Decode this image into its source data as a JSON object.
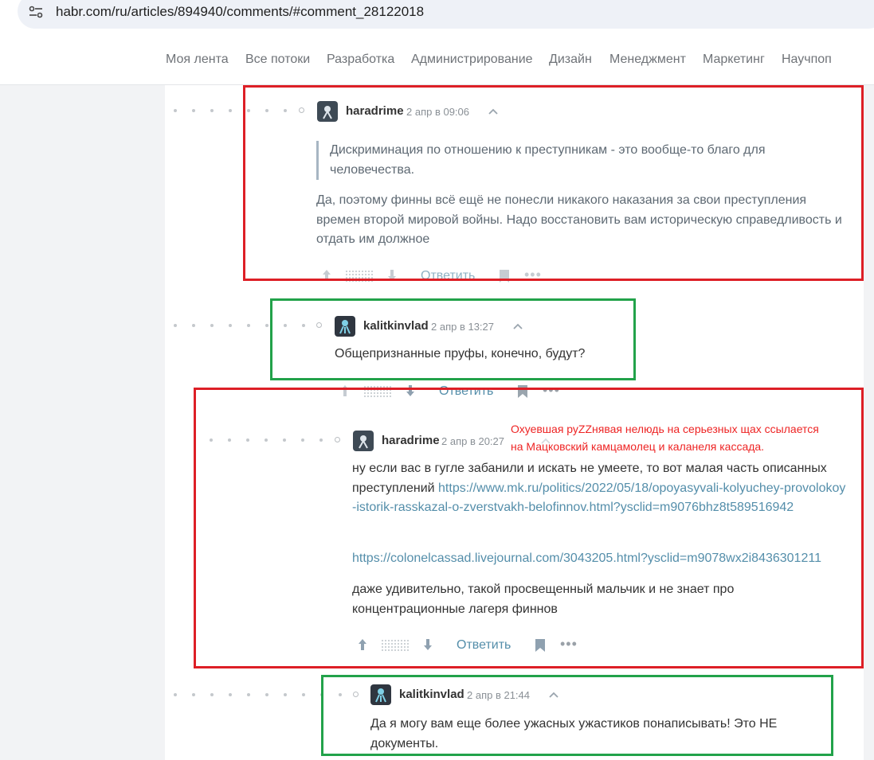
{
  "browser": {
    "url": "habr.com/ru/articles/894940/comments/#comment_28122018"
  },
  "nav": {
    "items": [
      "Моя лента",
      "Все потоки",
      "Разработка",
      "Администрирование",
      "Дизайн",
      "Менеджмент",
      "Маркетинг",
      "Научпоп"
    ]
  },
  "comments": [
    {
      "author": "haradrime",
      "time": "2 апр в 09:06",
      "quote": "Дискриминация по отношению к преступникам - это вообще-то благо для человечества.",
      "text": "Да, поэтому финны всё ещё не понесли никакого наказания за свои преступления времен второй мировой войны. Надо восстановить вам историческую справедливость и отдать им должное",
      "reply": "Ответить"
    },
    {
      "author": "kalitkinvlad",
      "time": "2 апр в 13:27",
      "text": "Общепризнанные пруфы, конечно, будут?",
      "reply": "Ответить"
    },
    {
      "author": "haradrime",
      "time": "2 апр в 20:27",
      "text_before_link": "ну если вас в гугле забанили и искать не умеете, то вот малая часть описанных преступлений",
      "link1": "https://www.mk.ru/politics/2022/05/18/opoyasyvali-kolyuchey-provolokoy-istorik-rasskazal-o-zverstvakh-belofinnov.html?ysclid=m9076bhz8t589516942",
      "link2": "https://colonelcassad.livejournal.com/3043205.html?ysclid=m9078wx2i8436301211",
      "text_after": "даже удивительно, такой просвещенный мальчик и не знает про концентрационные лагеря финнов",
      "reply": "Ответить"
    },
    {
      "author": "kalitkinvlad",
      "time": "2 апр в 21:44",
      "text": "Да я могу вам еще более ужасных ужастиков понаписывать! Это НЕ документы."
    }
  ],
  "annotation": {
    "line1": "Охуевшая руZZнявая нелюдь на серьезных щах ссылается",
    "line2": "на Мацковский камцамолец и каланеля кассада.",
    "color": "#ee2424"
  },
  "colors": {
    "highlight_red": "#dd1f26",
    "highlight_green": "#22a24a",
    "link": "#548eaa"
  }
}
